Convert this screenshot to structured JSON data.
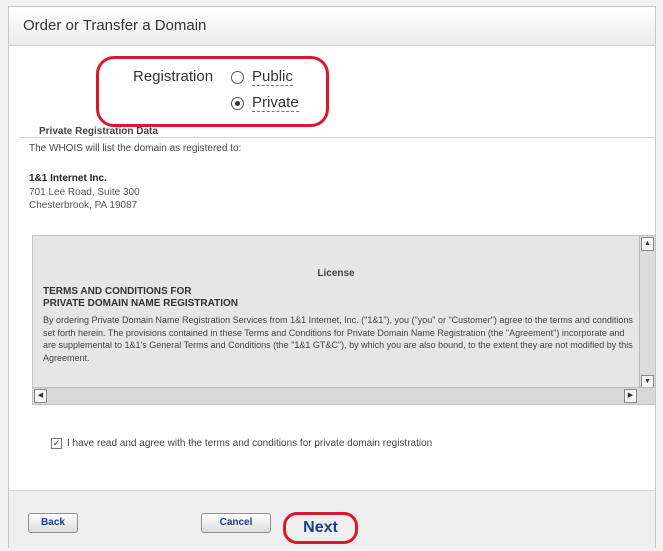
{
  "header": {
    "title": "Order or Transfer a Domain"
  },
  "registration": {
    "label": "Registration",
    "options": [
      {
        "label": "Public",
        "selected": false
      },
      {
        "label": "Private",
        "selected": true
      }
    ]
  },
  "private_data": {
    "section_title": "Private Registration Data",
    "whois_text": "The WHOIS will list the domain as registered to:",
    "company": "1&1 Internet Inc.",
    "address_line1": "701 Lee Road, Suite 300",
    "address_line2": "Chesterbrook, PA 19087"
  },
  "license": {
    "heading": "License",
    "terms_title_line1": "TERMS AND CONDITIONS FOR",
    "terms_title_line2": "PRIVATE DOMAIN NAME REGISTRATION",
    "body": "By ordering Private Domain Name Registration Services from 1&1 Internet, Inc. (\"1&1\"), you (\"you\" or \"Customer\") agree to the terms and conditions set forth herein. The provisions contained in these Terms and Conditions for Private Domain Name Registration (the \"Agreement\") incorporate and are supplemental to 1&1's General Terms and Conditions (the \"1&1 GT&C\"), by which you are also bound, to the extent they are not modified by this Agreement."
  },
  "agreement": {
    "checked": true,
    "label": "I have read and agree with the terms and conditions for private domain registration"
  },
  "footer": {
    "back_label": "Back",
    "cancel_label": "Cancel",
    "next_label": "Next"
  },
  "colors": {
    "highlight": "#d8192c",
    "button_text": "#1d3c8a"
  }
}
